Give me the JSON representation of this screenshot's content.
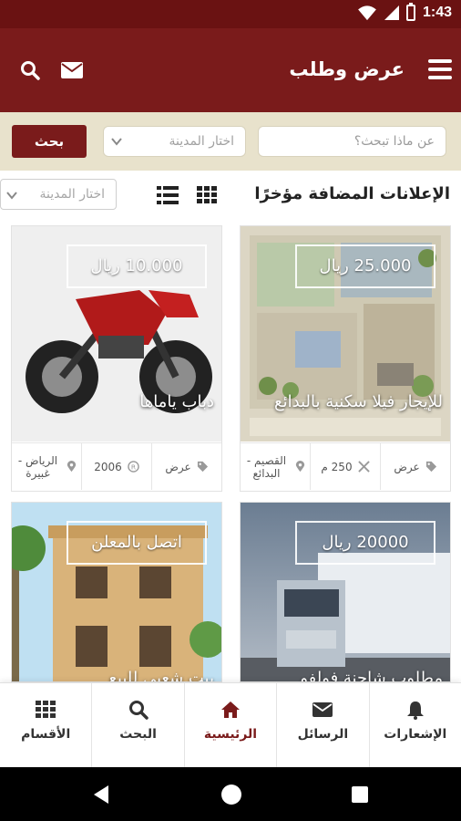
{
  "status_bar": {
    "time": "1:43"
  },
  "header": {
    "title": "عرض وطلب"
  },
  "search": {
    "placeholder": "عن ماذا تبحث؟",
    "city_placeholder": "اختار المدينة",
    "button_label": "بحث"
  },
  "section": {
    "title": "الإعلانات المضافة مؤخرًا",
    "city_placeholder": "اختار المدينة"
  },
  "listings": [
    {
      "price": "25.000 ريال",
      "title": "للإيجار فيلا سكنية بالبدائع",
      "meta": [
        {
          "icon": "tag-icon",
          "text": "عرض"
        },
        {
          "icon": "area-icon",
          "text": "250 م"
        },
        {
          "icon": "location-icon",
          "text": "القصيم - البدائع"
        }
      ]
    },
    {
      "price": "10.000 ريال",
      "title": "دباب ياماها",
      "meta": [
        {
          "icon": "tag-icon",
          "text": "عرض"
        },
        {
          "icon": "registered-icon",
          "text": "2006"
        },
        {
          "icon": "location-icon",
          "text": "الرياض - غبيرة"
        }
      ]
    },
    {
      "price": "20000 ريال",
      "title": "مطلوب شاحنة فولفو"
    },
    {
      "price": "اتصل بالمعلن",
      "title": "بيت شعبي للبيع"
    }
  ],
  "bottom_nav": [
    {
      "icon": "bell-icon",
      "label": "الإشعارات"
    },
    {
      "icon": "envelope-icon",
      "label": "الرسائل"
    },
    {
      "icon": "home-icon",
      "label": "الرئيسية",
      "active": true
    },
    {
      "icon": "search-icon",
      "label": "البحث"
    },
    {
      "icon": "grid-icon",
      "label": "الأقسام"
    }
  ],
  "colors": {
    "primary": "#7a1b1b",
    "status_bar": "#6a1212",
    "search_strip": "#e8e2cc"
  }
}
